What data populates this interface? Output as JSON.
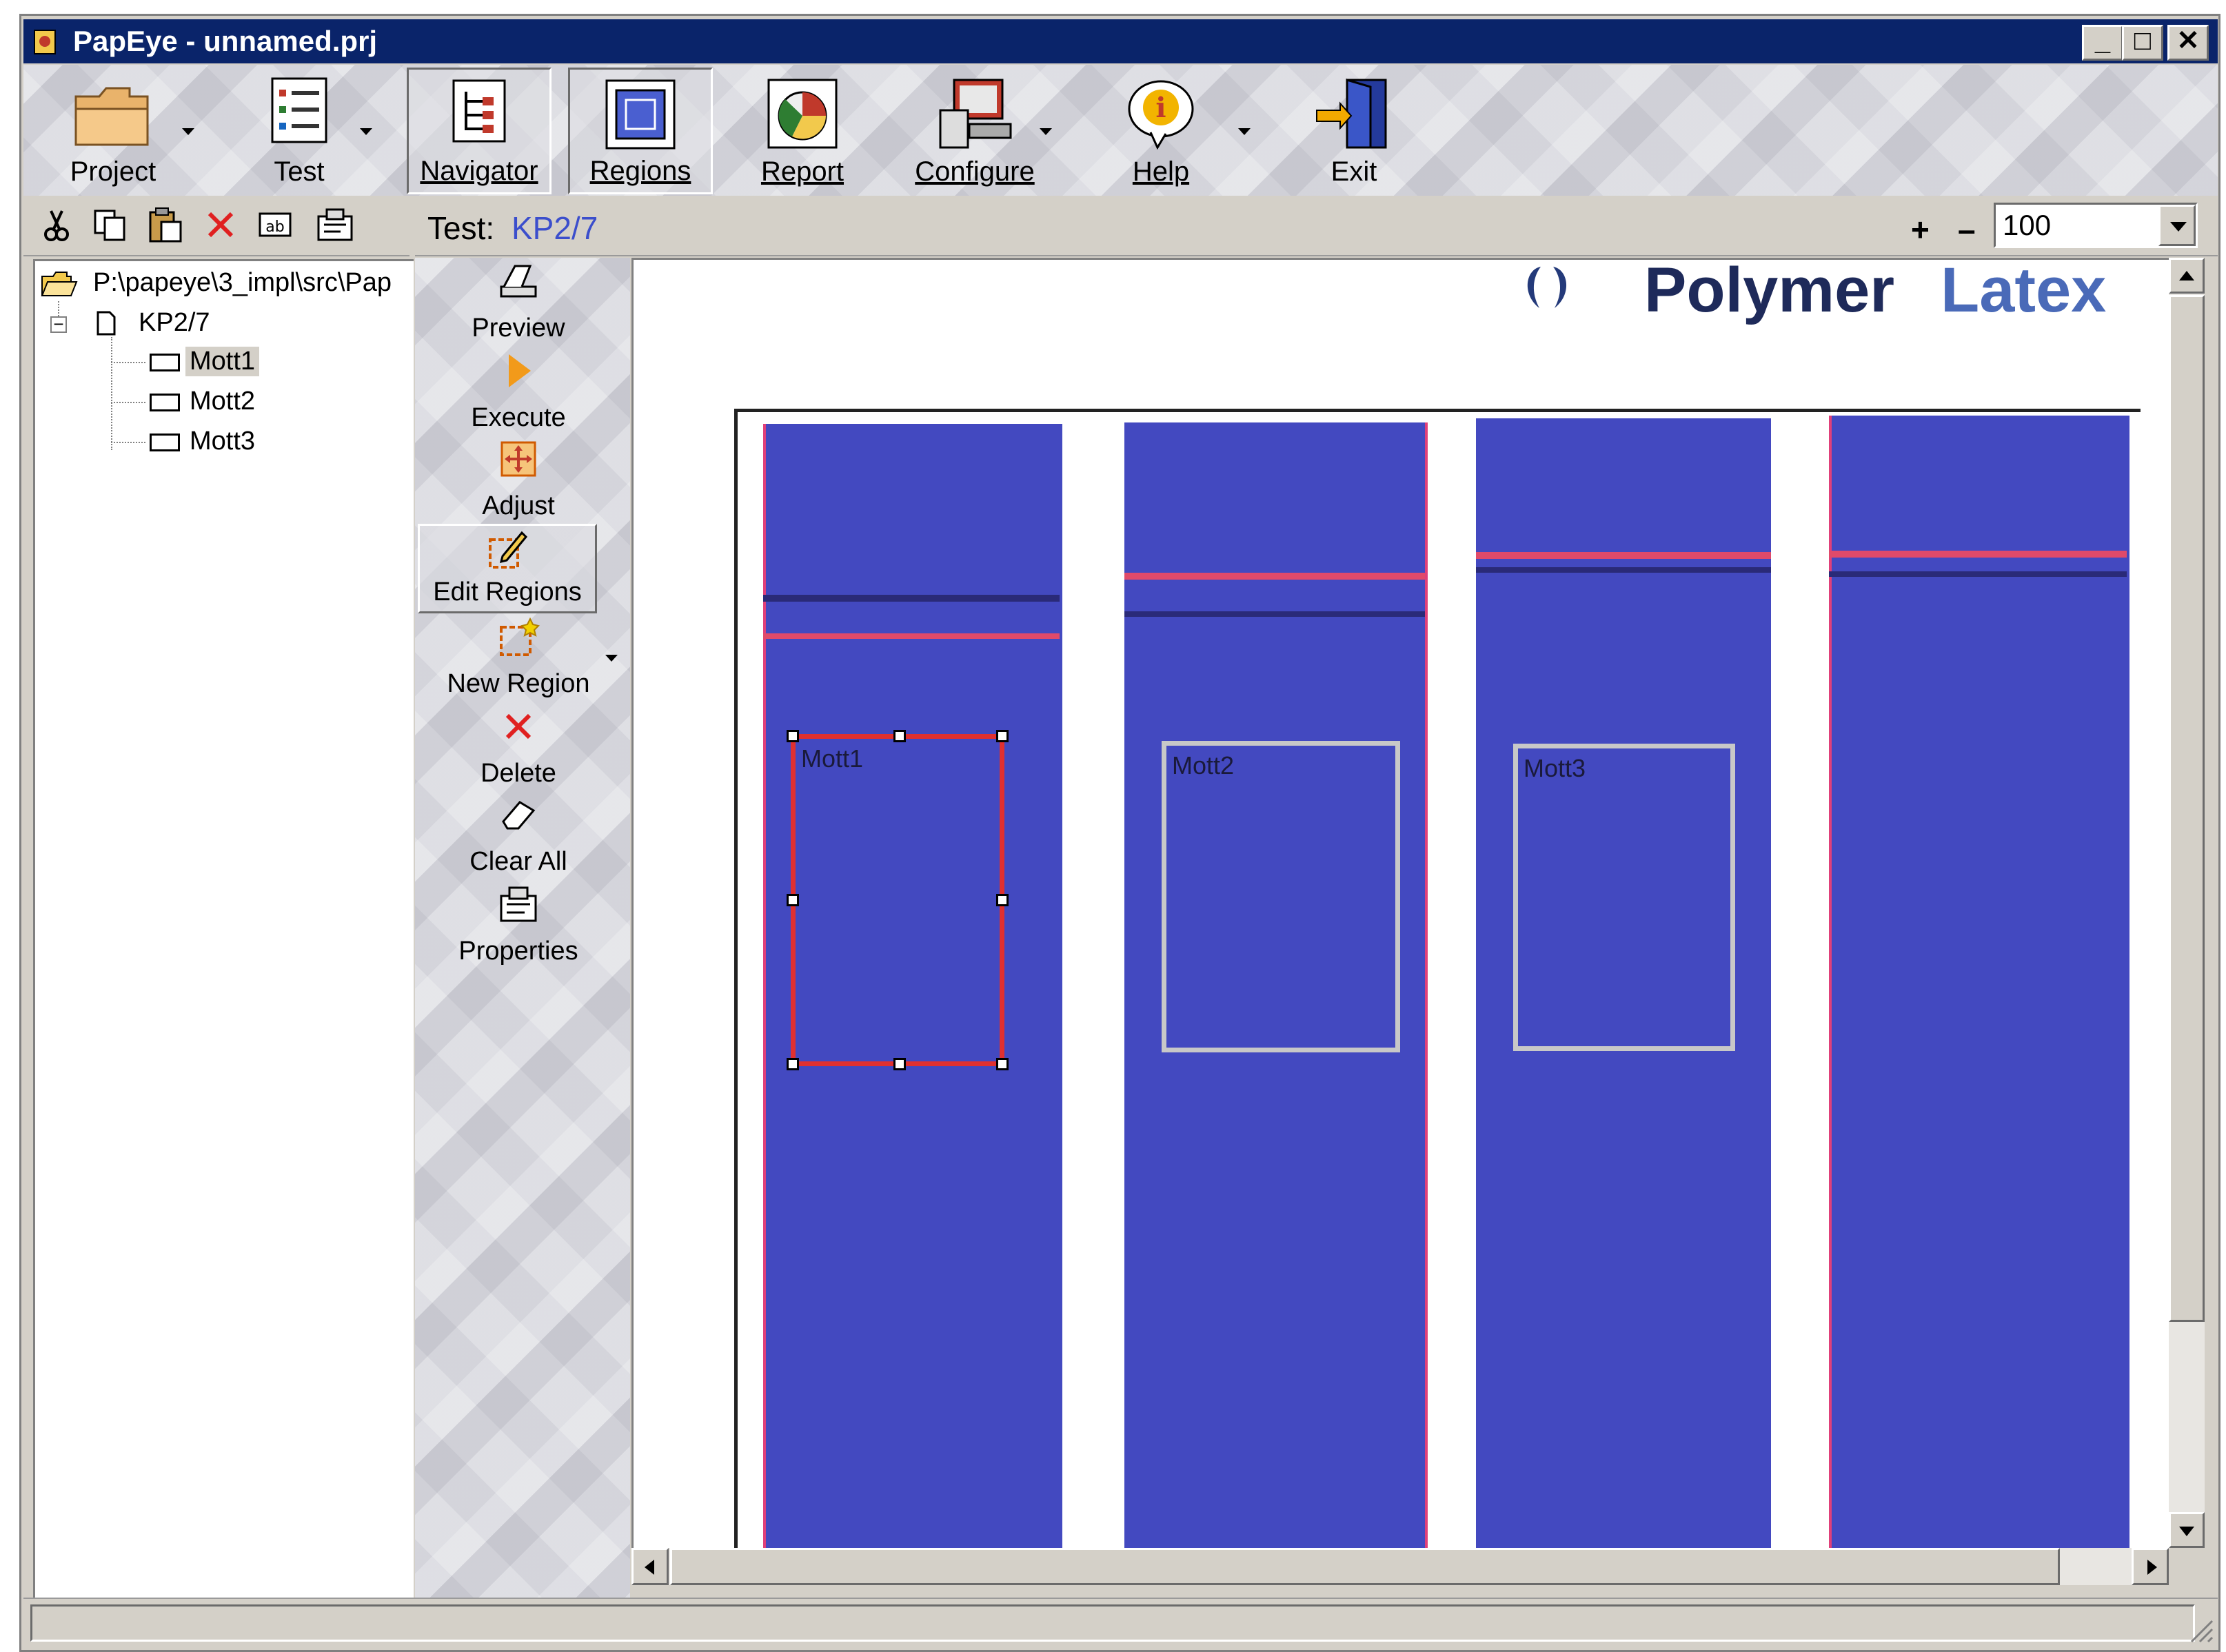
{
  "window": {
    "title": "PapEye - unnamed.prj",
    "controls": {
      "minimize": "_",
      "maximize": "□",
      "close": "✕"
    }
  },
  "toolbar": {
    "items": [
      {
        "label": "Project",
        "icon": "folder-icon"
      },
      {
        "label": "Test",
        "icon": "checklist-icon"
      },
      {
        "label": "Navigator",
        "icon": "tree-icon"
      },
      {
        "label": "Regions",
        "icon": "regions-icon"
      },
      {
        "label": "Report",
        "icon": "report-icon"
      },
      {
        "label": "Configure",
        "icon": "computer-icon"
      },
      {
        "label": "Help",
        "icon": "info-balloon-icon"
      },
      {
        "label": "Exit",
        "icon": "door-icon"
      }
    ]
  },
  "edit_toolbar": {
    "icons": [
      "cut-icon",
      "copy-icon",
      "paste-icon",
      "delete-icon",
      "rename-icon",
      "properties-icon"
    ]
  },
  "testbar": {
    "prefix": "Test:",
    "value": "KP2/7",
    "zoom_plus": "+",
    "zoom_minus": "–",
    "zoom_value": "100"
  },
  "tree": {
    "root": "P:\\papeye\\3_impl\\src\\Pap",
    "test": "KP2/7",
    "regions": [
      "Mott1",
      "Mott2",
      "Mott3"
    ],
    "expander": "−"
  },
  "side_actions": [
    {
      "label": "Preview",
      "icon": "scanner-icon"
    },
    {
      "label": "Execute",
      "icon": "play-icon"
    },
    {
      "label": "Adjust",
      "icon": "adjust-icon"
    },
    {
      "label": "Edit Regions",
      "icon": "edit-region-icon"
    },
    {
      "label": "New Region",
      "icon": "new-region-icon"
    },
    {
      "label": "Delete",
      "icon": "delete-icon"
    },
    {
      "label": "Clear All",
      "icon": "eraser-icon"
    },
    {
      "label": "Properties",
      "icon": "properties-icon"
    }
  ],
  "image": {
    "logo_text_a": "Polymer",
    "logo_text_b": "Latex",
    "regions": [
      "Mott1",
      "Mott2",
      "Mott3"
    ]
  },
  "colors": {
    "titlebar": "#0a246a",
    "strip": "#4349c0",
    "selected_region": "#e03030",
    "region": "#c8c8c8",
    "test_value": "#3b4ecc"
  }
}
